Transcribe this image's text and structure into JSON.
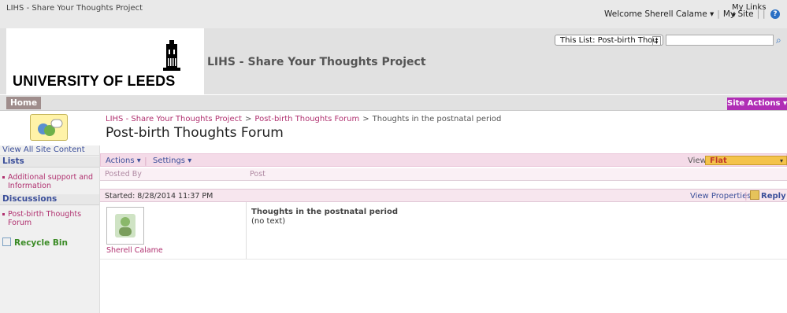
{
  "topbar": {
    "site_name": "LIHS - Share Your Thoughts Project",
    "welcome": "Welcome Sherell Calame ▾",
    "my_site": "My Site",
    "my_links": "My Links",
    "my_links_arrow": "▾",
    "help": "?"
  },
  "header": {
    "logo_text": "UNIVERSITY OF LEEDS",
    "site_title": "LIHS - Share Your Thoughts Project",
    "search_scope": "This List: Post-birth Thou",
    "search_placeholder": "",
    "search_go": "⌕"
  },
  "nav": {
    "home": "Home",
    "site_actions": "Site Actions ▾"
  },
  "title_area": {
    "breadcrumb": [
      "LIHS - Share Your Thoughts Project",
      "Post-birth Thoughts Forum",
      "Thoughts in the postnatal period"
    ],
    "breadcrumb_sep": ">",
    "page_title": "Post-birth Thoughts Forum"
  },
  "leftnav": {
    "view_all": "View All Site Content",
    "lists_heading": "Lists",
    "lists_items": [
      "Additional support and Information"
    ],
    "discussions_heading": "Discussions",
    "discussions_items": [
      "Post-birth Thoughts Forum"
    ],
    "recycle_bin": "Recycle Bin"
  },
  "toolbar": {
    "actions": "Actions ▾",
    "settings": "Settings ▾",
    "view_label": "View:",
    "view_value": "Flat",
    "view_arrow": "▾"
  },
  "columns": {
    "posted_by": "Posted By",
    "post": "Post"
  },
  "thread": {
    "started": "Started: 8/28/2014 11:37 PM",
    "view_properties": "View Properties",
    "reply": "Reply",
    "author": "Sherell Calame",
    "post_title": "Thoughts in the postnatal period",
    "post_text": "(no text)"
  },
  "colors": {
    "accent_pink": "#b0306f",
    "site_actions": "#b02eb5",
    "home_tab": "#9f8d8c",
    "view_select": "#f4c34b"
  }
}
